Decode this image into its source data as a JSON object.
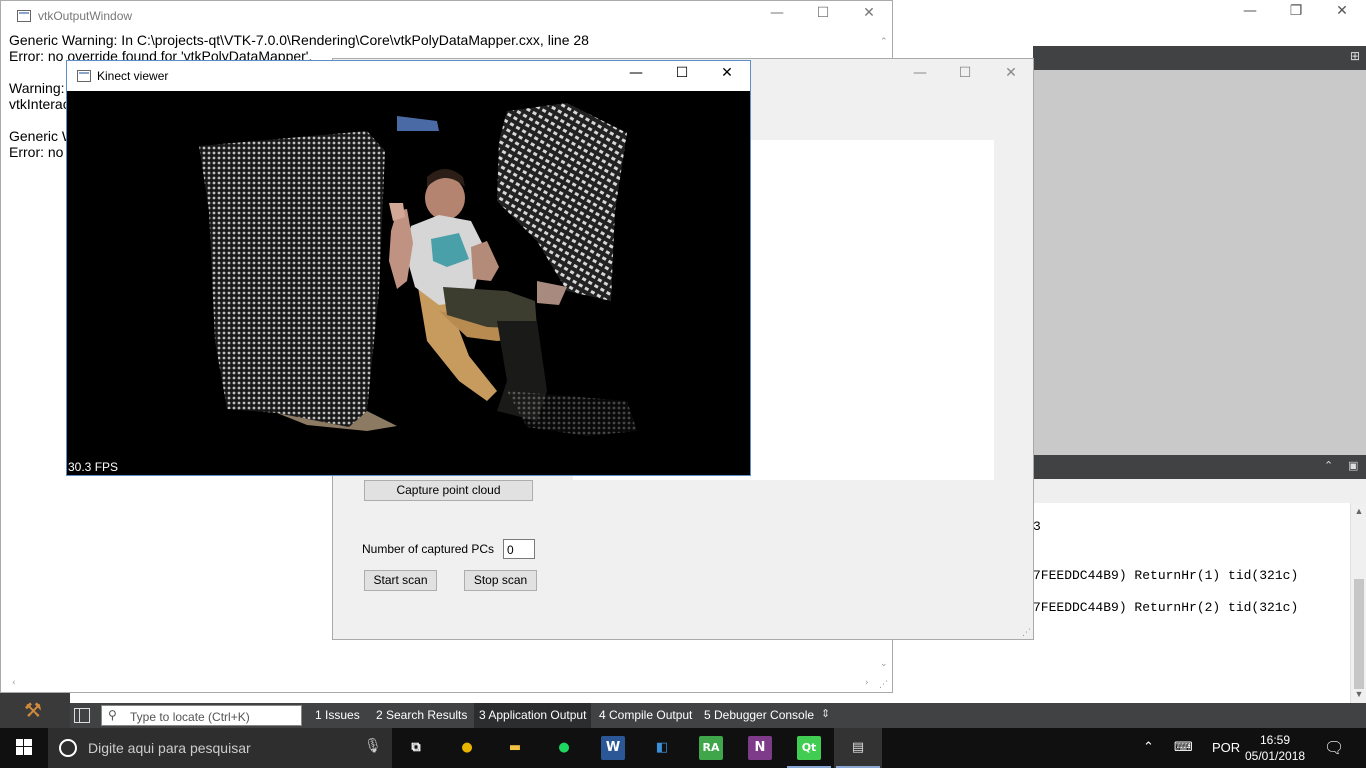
{
  "qtcreator": {
    "caption": {
      "minimize": "—",
      "restore": "❐",
      "close": "✕"
    },
    "split_icon": "⊞",
    "output_pane_icons": {
      "collapse": "⌃",
      "float": "▣"
    },
    "output_lines": [
      "3",
      "7FEEDDC44B9) ReturnHr(1) tid(321c)",
      "7FEEDDC44B9) ReturnHr(2) tid(321c)"
    ],
    "locator_placeholder": "Type to locate (Ctrl+K)",
    "bottom_tabs": [
      {
        "label": "1  Issues"
      },
      {
        "label": "2  Search Results"
      },
      {
        "label": "3  Application Output",
        "active": true
      },
      {
        "label": "4  Compile Output"
      },
      {
        "label": "5  Debugger Console"
      }
    ],
    "tabs_more": "⇕"
  },
  "vtk_window": {
    "title": "vtkOutputWindow",
    "lines": [
      "Generic Warning: In C:\\projects-qt\\VTK-7.0.0\\Rendering\\Core\\vtkPolyDataMapper.cxx, line 28",
      "Error: no override found for 'vtkPolyDataMapper'.",
      "",
      "Warning:",
      "vtkInterac",
      "",
      "Generic W",
      "Error: no"
    ]
  },
  "app_window": {
    "capture_button": "Capture point cloud",
    "captured_label": "Number of captured PCs",
    "captured_value": "0",
    "start_button": "Start scan",
    "stop_button": "Stop scan"
  },
  "kinect_window": {
    "title": "Kinect viewer",
    "fps": "30.3 FPS"
  },
  "taskbar": {
    "search_placeholder": "Digite aqui para pesquisar",
    "language": "POR",
    "time": "16:59",
    "date": "05/01/2018",
    "apps": [
      {
        "name": "task-view",
        "glyph": "⧉",
        "color": "#ffffff"
      },
      {
        "name": "chrome",
        "glyph": "●",
        "color": "#e8b400"
      },
      {
        "name": "file-explorer",
        "glyph": "▬",
        "color": "#f3c443"
      },
      {
        "name": "spotify",
        "glyph": "●",
        "color": "#1ed760"
      },
      {
        "name": "word",
        "glyph": "W",
        "color": "#2b5797"
      },
      {
        "name": "outlook",
        "glyph": "◧",
        "color": "#3a8fd6"
      },
      {
        "name": "robot-assistant",
        "glyph": "RA",
        "color": "#3fa64a"
      },
      {
        "name": "onenote",
        "glyph": "N",
        "color": "#7e3b8a"
      },
      {
        "name": "qt-creator",
        "glyph": "Qt",
        "color": "#41cd52"
      },
      {
        "name": "application-window",
        "glyph": "▤",
        "color": "#dddddd"
      }
    ]
  }
}
